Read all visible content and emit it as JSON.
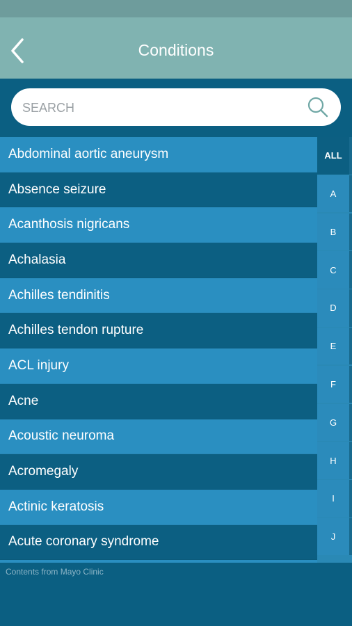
{
  "header": {
    "title": "Conditions",
    "back_icon": "chevron-left-icon"
  },
  "search": {
    "placeholder": "SEARCH",
    "value": "",
    "icon": "search-icon"
  },
  "conditions": [
    "Abdominal aortic aneurysm",
    "Absence seizure",
    "Acanthosis nigricans",
    "Achalasia",
    "Achilles tendinitis",
    "Achilles tendon rupture",
    "ACL injury",
    "Acne",
    "Acoustic neuroma",
    "Acromegaly",
    "Actinic keratosis",
    "Acute coronary syndrome"
  ],
  "alphabet": {
    "letters": [
      "ALL",
      "A",
      "B",
      "C",
      "D",
      "E",
      "F",
      "G",
      "H",
      "I",
      "J"
    ],
    "active": "ALL"
  },
  "footer": {
    "text": "Contents from Mayo Clinic"
  },
  "colors": {
    "header_bg": "#80b3b1",
    "statusbar_bg": "#6e9c9c",
    "page_bg": "#0b5f82",
    "row_light": "#2a8fc1",
    "row_dark": "#0c5f82"
  }
}
